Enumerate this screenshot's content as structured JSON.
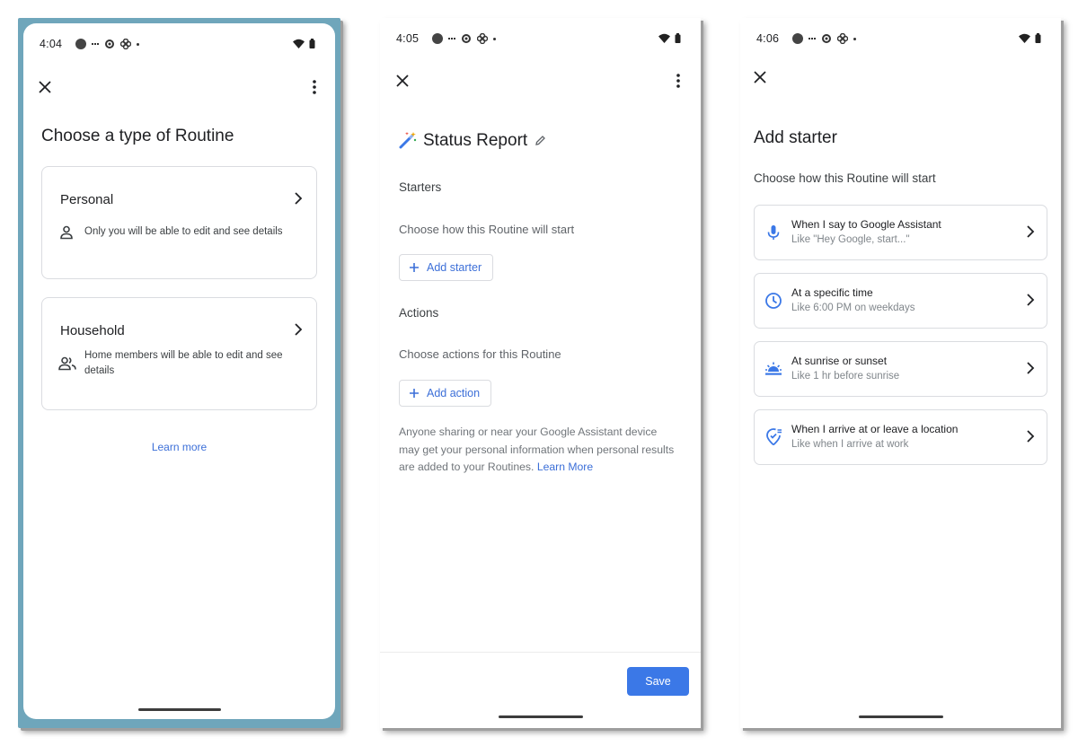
{
  "screens": [
    {
      "time": "4:04",
      "title": "Choose a type of Routine",
      "cards": [
        {
          "title": "Personal",
          "description": "Only you will be able to edit and see details"
        },
        {
          "title": "Household",
          "description": "Home members will be able to edit and see details"
        }
      ],
      "learn_more": "Learn more"
    },
    {
      "time": "4:05",
      "title": "Status Report",
      "starters_heading": "Starters",
      "starters_sub": "Choose how this Routine will start",
      "add_starter": "Add starter",
      "actions_heading": "Actions",
      "actions_sub": "Choose actions for this Routine",
      "add_action": "Add action",
      "note": "Anyone sharing or near your Google Assistant device may get your personal information when personal results are added to your Routines.",
      "note_link": "Learn More",
      "save": "Save"
    },
    {
      "time": "4:06",
      "title": "Add starter",
      "subtitle": "Choose how this Routine will start",
      "options": [
        {
          "title": "When I say to Google Assistant",
          "subtitle": "Like \"Hey Google, start...\"",
          "icon": "microphone-icon"
        },
        {
          "title": "At a specific time",
          "subtitle": "Like 6:00 PM on weekdays",
          "icon": "clock-icon"
        },
        {
          "title": "At sunrise or sunset",
          "subtitle": "Like 1 hr before sunrise",
          "icon": "sunrise-icon"
        },
        {
          "title": "When I arrive at or leave a location",
          "subtitle": "Like when I arrive at work",
          "icon": "location-icon"
        }
      ]
    }
  ],
  "colors": {
    "accent": "#3b78e7",
    "link": "#3c6fd8",
    "frame": "#6fa6bb",
    "border": "#dadce0"
  }
}
